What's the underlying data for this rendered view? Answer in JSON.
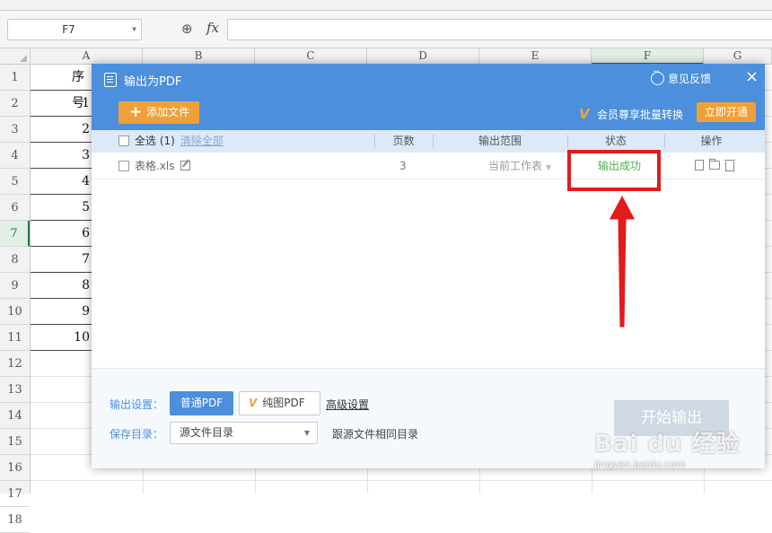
{
  "formula_bar": {
    "cell_ref": "F7",
    "zoom_icon": "zoom-icon",
    "fx_label": "fx",
    "input_value": ""
  },
  "spreadsheet": {
    "columns": [
      "A",
      "B",
      "C",
      "D",
      "E",
      "F",
      "G"
    ],
    "active_column": "F",
    "rows": [
      "1",
      "2",
      "3",
      "4",
      "5",
      "6",
      "7",
      "8",
      "9",
      "10",
      "11",
      "12",
      "13",
      "14",
      "15",
      "16",
      "17",
      "18"
    ],
    "active_row": "7",
    "column_a_values": [
      "序号",
      "1",
      "2",
      "3",
      "4",
      "5",
      "6",
      "7",
      "8",
      "9",
      "10"
    ]
  },
  "dialog": {
    "title": "输出为PDF",
    "feedback": "意见反馈",
    "close": "×",
    "add_file": "添加文件",
    "vip_text": "会员尊享批量转换",
    "vip_button": "立即开通",
    "table": {
      "select_all": "全选 (1)",
      "clear_all": "清除全部",
      "col_pages": "页数",
      "col_range": "输出范围",
      "col_status": "状态",
      "col_actions": "操作",
      "rows": [
        {
          "file": "表格.xls",
          "pages": "3",
          "range": "当前工作表",
          "status": "输出成功"
        }
      ]
    },
    "footer": {
      "output_settings_label": "输出设置：",
      "normal_pdf": "普通PDF",
      "image_pdf": "纯图PDF",
      "advanced": "高级设置",
      "save_dir_label": "保存目录：",
      "save_dir_value": "源文件目录",
      "save_dir_hint": "跟源文件相同目录",
      "start_export": "开始输出"
    }
  },
  "watermark": {
    "brand": "Bai du 经验",
    "url": "jingyan.baidu.com"
  },
  "colors": {
    "header_blue": "#4b8fdd",
    "orange": "#f0a038",
    "success_green": "#4caf50",
    "annotation_red": "#e21b1b"
  }
}
